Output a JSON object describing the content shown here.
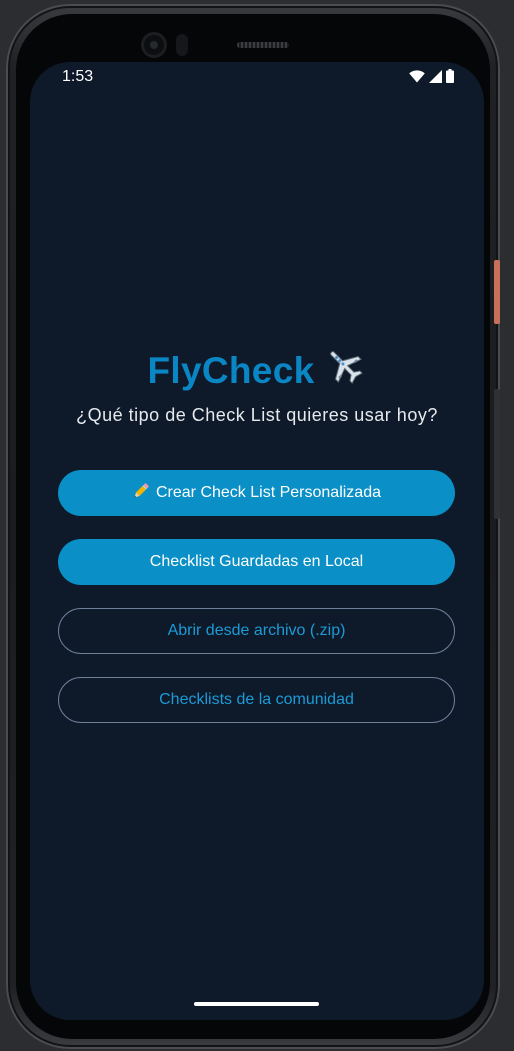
{
  "status_bar": {
    "time": "1:53",
    "icons": [
      "wifi-icon",
      "cell-signal-icon",
      "battery-icon"
    ]
  },
  "app": {
    "title": "FlyCheck",
    "title_icon": "airplane-emoji",
    "subtitle": "¿Qué tipo de Check List quieres usar hoy?"
  },
  "buttons": {
    "create": {
      "label": "Crear Check List Personalizada",
      "icon": "pencil-emoji"
    },
    "local": {
      "label": "Checklist Guardadas en Local"
    },
    "open_zip": {
      "label": "Abrir desde archivo (.zip)"
    },
    "community": {
      "label": "Checklists de la comunidad"
    }
  },
  "colors": {
    "background": "#0e1a2a",
    "accent": "#0a8fc6",
    "title": "#0a86c4",
    "outline_text": "#1b9ad6",
    "outline_border": "#6e7f98"
  }
}
